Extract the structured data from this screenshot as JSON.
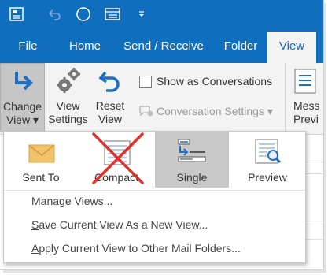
{
  "quick_access": {
    "icons": [
      "send-receive-icon",
      "undo-icon",
      "circle-icon",
      "list-icon",
      "customize-dropdown-icon"
    ]
  },
  "tabs": [
    "File",
    "Home",
    "Send / Receive",
    "Folder",
    "View"
  ],
  "active_tab": "View",
  "ribbon": {
    "change_view": {
      "line1": "Change",
      "line2": "View ▾"
    },
    "view_settings": {
      "line1": "View",
      "line2": "Settings"
    },
    "reset_view": {
      "line1": "Reset",
      "line2": "View"
    },
    "show_as_conversations": "Show as Conversations",
    "conversation_settings": "Conversation Settings ▾",
    "message_preview": {
      "line1": "Mess",
      "line2": "Previ"
    }
  },
  "view_gallery": [
    {
      "label": "Sent To",
      "icon": "envelope-icon",
      "selected": false
    },
    {
      "label": "Compact",
      "icon": "compact-view-icon",
      "selected": false,
      "crossed_out": true
    },
    {
      "label": "Single",
      "icon": "single-view-icon",
      "selected": true
    },
    {
      "label": "Preview",
      "icon": "preview-view-icon",
      "selected": false
    }
  ],
  "menu_items": [
    {
      "hotkey": "M",
      "rest": "anage Views..."
    },
    {
      "hotkey": "S",
      "rest": "ave Current View As a New View..."
    },
    {
      "hotkey": "A",
      "rest": "pply Current View to Other Mail Folders..."
    }
  ],
  "colors": {
    "ribbon_blue": "#106ebe",
    "cross_red": "#e0302a"
  }
}
